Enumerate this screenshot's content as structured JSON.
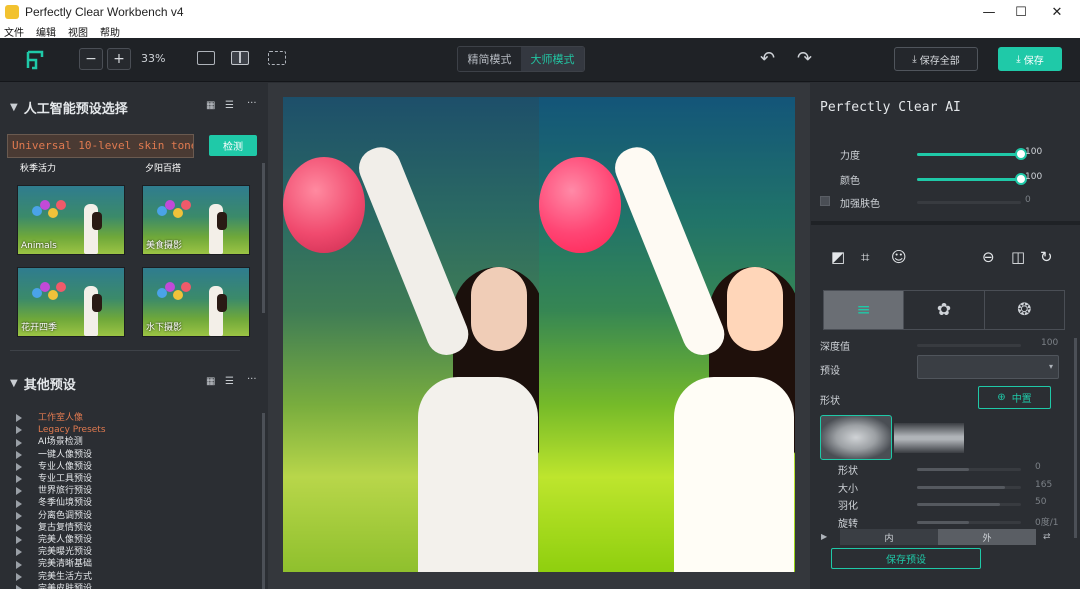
{
  "window": {
    "title": "Perfectly Clear Workbench v4",
    "controls": [
      "—",
      "☐",
      "✕"
    ]
  },
  "menu": [
    "文件",
    "编辑",
    "视图",
    "帮助"
  ],
  "toolbar": {
    "minus": "−",
    "plus": "+",
    "zoom": "33%",
    "mode_simple": "精简模式",
    "mode_master": "大师模式",
    "undo": "↶",
    "redo": "↷",
    "save_all": "保存全部",
    "save": "保存",
    "accent": "#1fc9a8"
  },
  "left_panel": {
    "ai_section_title": "人工智能预设选择",
    "search_value": "Universal 10-level skin tone",
    "detect_label": "检测",
    "thumb_cut_labels": [
      "秋季活力",
      "夕阳百搭"
    ],
    "thumbnails": [
      {
        "label": "Animals"
      },
      {
        "label": "美食摄影"
      },
      {
        "label": "花开四季"
      },
      {
        "label": "水下摄影"
      }
    ],
    "other_section_title": "其他预设",
    "tree_items": [
      {
        "label": "工作室人像",
        "color": "#e07a50"
      },
      {
        "label": "Legacy Presets",
        "color": "#e07a50"
      },
      {
        "label": "AI场景检测",
        "color": "#e4e7ea"
      },
      {
        "label": "一键人像预设",
        "color": "#e4e7ea"
      },
      {
        "label": "专业人像预设",
        "color": "#e4e7ea"
      },
      {
        "label": "专业工具预设",
        "color": "#e4e7ea"
      },
      {
        "label": "世界旅行预设",
        "color": "#e4e7ea"
      },
      {
        "label": "冬季仙境预设",
        "color": "#e4e7ea"
      },
      {
        "label": "分离色调预设",
        "color": "#e4e7ea"
      },
      {
        "label": "复古复情预设",
        "color": "#e4e7ea"
      },
      {
        "label": "完美人像预设",
        "color": "#e4e7ea"
      },
      {
        "label": "完美曝光预设",
        "color": "#e4e7ea"
      },
      {
        "label": "完美清晰基础",
        "color": "#e4e7ea"
      },
      {
        "label": "完美生活方式",
        "color": "#e4e7ea"
      },
      {
        "label": "完美皮肤预设",
        "color": "#e4e7ea"
      }
    ]
  },
  "right_panel": {
    "title": "Perfectly Clear AI",
    "strength_label": "力度",
    "strength_value": "100",
    "strength_level": 1.0,
    "color_label": "颜色",
    "color_value": "100",
    "color_level": 1.0,
    "enhance_skin_label": "加强肤色",
    "enhance_skin_value": "0",
    "cut_label": "深度值",
    "cut_value": "100",
    "preset_label": "预设",
    "shape_label": "形状",
    "center_btn": "中置",
    "shape_sliders": [
      {
        "label": "形状",
        "value": "0",
        "level": 0.5
      },
      {
        "label": "大小",
        "value": "165",
        "level": 0.85
      },
      {
        "label": "羽化",
        "value": "50",
        "level": 0.8
      },
      {
        "label": "旋转",
        "value": "0度/1",
        "level": 0.5
      }
    ],
    "bottom_tabs": [
      "内",
      "外"
    ],
    "save_preset": "保存预设"
  }
}
